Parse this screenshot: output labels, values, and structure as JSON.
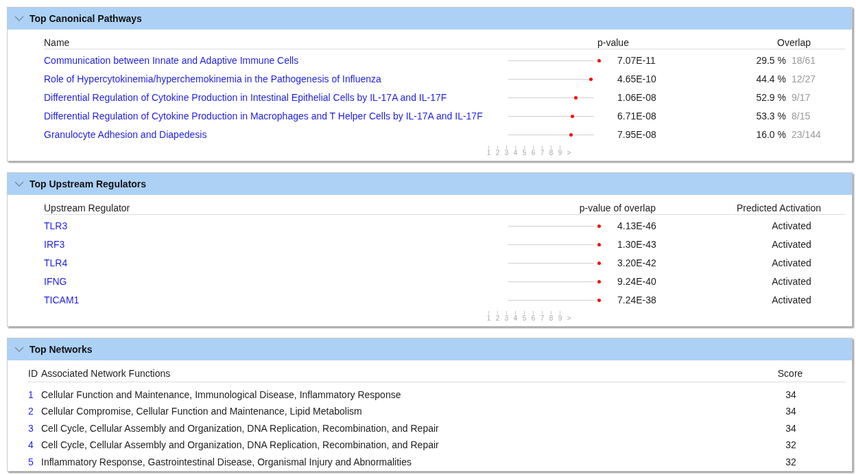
{
  "panels": [
    {
      "kind": "pathways",
      "title": "Top Canonical Pathways",
      "expanded": true,
      "columns": [
        "Name",
        "p-value",
        "Overlap"
      ],
      "rows": [
        {
          "name": "Communication between Innate and Adaptive Immune Cells",
          "level": 0.98,
          "p_value": "7.07E-11",
          "percent": "29.5 %",
          "ratio": "18/61"
        },
        {
          "name": "Role of Hypercytokinemia/hyperchemokinemia in the Pathogenesis of Influenza",
          "level": 0.89,
          "p_value": "4.65E-10",
          "percent": "44.4 %",
          "ratio": "12/27"
        },
        {
          "name": "Differential Regulation of Cytokine Production in Intestinal Epithelial Cells by IL-17A and IL-17F",
          "level": 0.73,
          "p_value": "1.06E-08",
          "percent": "52.9 %",
          "ratio": "9/17"
        },
        {
          "name": "Differential Regulation of Cytokine Production in Macrophages and T Helper Cells by IL-17A and IL-17F",
          "level": 0.69,
          "p_value": "6.71E-08",
          "percent": "53.3 %",
          "ratio": "8/15"
        },
        {
          "name": "Granulocyte Adhesion and Diapedesis",
          "level": 0.68,
          "p_value": "7.95E-08",
          "percent": "16.0 %",
          "ratio": "23/144"
        }
      ],
      "scale": [
        "1",
        "2",
        "3",
        "4",
        "5",
        "6",
        "7",
        "8",
        "9",
        ">"
      ]
    },
    {
      "kind": "regulators",
      "title": "Top Upstream Regulators",
      "expanded": true,
      "columns": [
        "Upstream Regulator",
        "p-value of overlap",
        "Predicted Activation"
      ],
      "rows": [
        {
          "name": "TLR3",
          "level": 0.98,
          "p_value": "4.13E-46",
          "activation": "Activated"
        },
        {
          "name": "IRF3",
          "level": 0.98,
          "p_value": "1.30E-43",
          "activation": "Activated"
        },
        {
          "name": "TLR4",
          "level": 0.98,
          "p_value": "3.20E-42",
          "activation": "Activated"
        },
        {
          "name": "IFNG",
          "level": 0.98,
          "p_value": "9.24E-40",
          "activation": "Activated"
        },
        {
          "name": "TICAM1",
          "level": 0.98,
          "p_value": "7.24E-38",
          "activation": "Activated"
        }
      ],
      "scale": [
        "1",
        "2",
        "3",
        "4",
        "5",
        "6",
        "7",
        "8",
        "9",
        ">"
      ]
    },
    {
      "kind": "networks",
      "title": "Top Networks",
      "expanded": true,
      "columns": [
        "ID",
        "Associated Network Functions",
        "Score"
      ],
      "rows": [
        {
          "id": "1",
          "functions": "Cellular Function and Maintenance, Immunological Disease, Inflammatory Response",
          "score": "34"
        },
        {
          "id": "2",
          "functions": "Cellular Compromise, Cellular Function and Maintenance, Lipid Metabolism",
          "score": "34"
        },
        {
          "id": "3",
          "functions": "Cell Cycle, Cellular Assembly and Organization, DNA Replication, Recombination, and Repair",
          "score": "34"
        },
        {
          "id": "4",
          "functions": "Cell Cycle, Cellular Assembly and Organization, DNA Replication, Recombination, and Repair",
          "score": "32"
        },
        {
          "id": "5",
          "functions": "Inflammatory Response, Gastrointestinal Disease, Organismal Injury and Abnormalities",
          "score": "32"
        }
      ]
    }
  ]
}
